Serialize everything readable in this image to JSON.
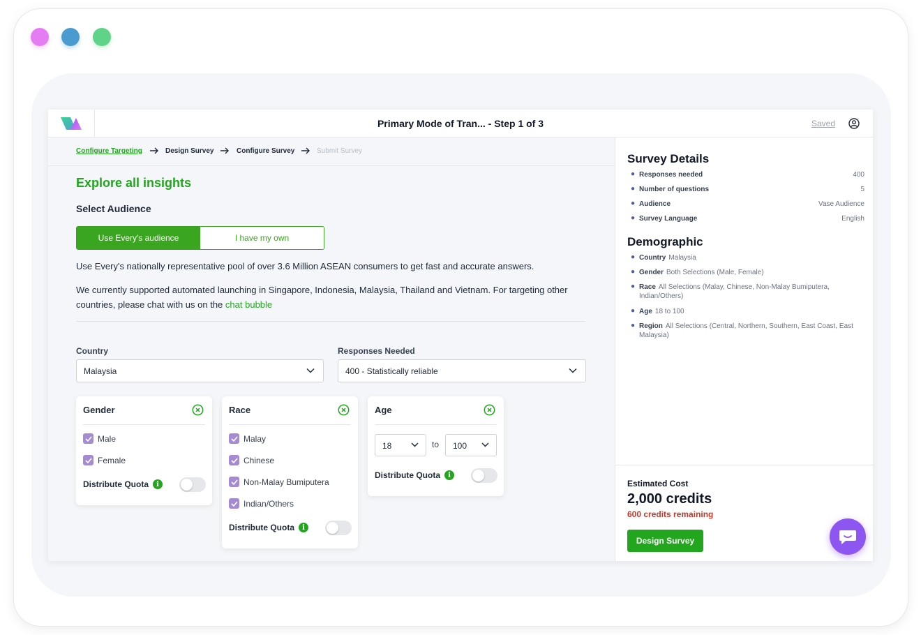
{
  "header": {
    "title": "Primary Mode of Tran...  - Step 1 of 3",
    "saved": "Saved"
  },
  "steps": [
    {
      "label": "Configure Targeting"
    },
    {
      "label": "Design Survey"
    },
    {
      "label": "Configure Survey"
    },
    {
      "label": "Submit Survey"
    }
  ],
  "main": {
    "heading": "Explore all insights",
    "subheading": "Select Audience",
    "audience_tabs": [
      "Use Every's audience",
      "I have my own"
    ],
    "intro": "Use Every's nationally representative pool of over 3.6 Million ASEAN consumers to get fast and accurate answers.",
    "note": "We currently supported automated launching in Singapore, Indonesia, Malaysia, Thailand and Vietnam. For targeting other countries, please chat with us on the",
    "note_link": "chat bubble",
    "country_label": "Country",
    "country_value": "Malaysia",
    "responses_label": "Responses Needed",
    "responses_value": "400 - Statistically reliable"
  },
  "cards": {
    "gender": {
      "title": "Gender",
      "options": [
        "Male",
        "Female"
      ],
      "quota": "Distribute Quota"
    },
    "race": {
      "title": "Race",
      "options": [
        "Malay",
        "Chinese",
        "Non-Malay Bumiputera",
        "Indian/Others"
      ],
      "quota": "Distribute Quota"
    },
    "age": {
      "title": "Age",
      "from": "18",
      "to_label": "to",
      "to": "100",
      "quota": "Distribute Quota"
    }
  },
  "info_glyph": "i",
  "sidebar": {
    "details_title": "Survey Details",
    "details": [
      {
        "key": "Responses needed",
        "value": "400"
      },
      {
        "key": "Number of questions",
        "value": "5"
      },
      {
        "key": "Audience",
        "value": "Vase Audience"
      },
      {
        "key": "Survey Language",
        "value": "English"
      }
    ],
    "demo_title": "Demographic",
    "demographics": [
      {
        "key": "Country",
        "value": "Malaysia"
      },
      {
        "key": "Gender",
        "value": "Both Selections (Male, Female)"
      },
      {
        "key": "Race",
        "value": "All Selections (Malay, Chinese, Non-Malay Bumiputera, Indian/Others)"
      },
      {
        "key": "Age",
        "value": "18 to 100"
      },
      {
        "key": "Region",
        "value": "All Selections (Central, Northern, Southern, East Coast, East Malaysia)"
      }
    ],
    "cost_label": "Estimated Cost",
    "cost_value": "2,000 credits",
    "cost_remaining": "600 credits remaining",
    "design_button": "Design Survey"
  },
  "colors": {
    "accent": "#22a61e",
    "checkbox": "#a58bd2",
    "chat": "#8e56f0",
    "remaining": "#c0392b"
  },
  "icons": [
    "logo-icon",
    "user-icon",
    "arrow-right-icon",
    "chevron-down-icon",
    "close-circle-icon",
    "check-icon",
    "info-icon",
    "chat-icon"
  ]
}
